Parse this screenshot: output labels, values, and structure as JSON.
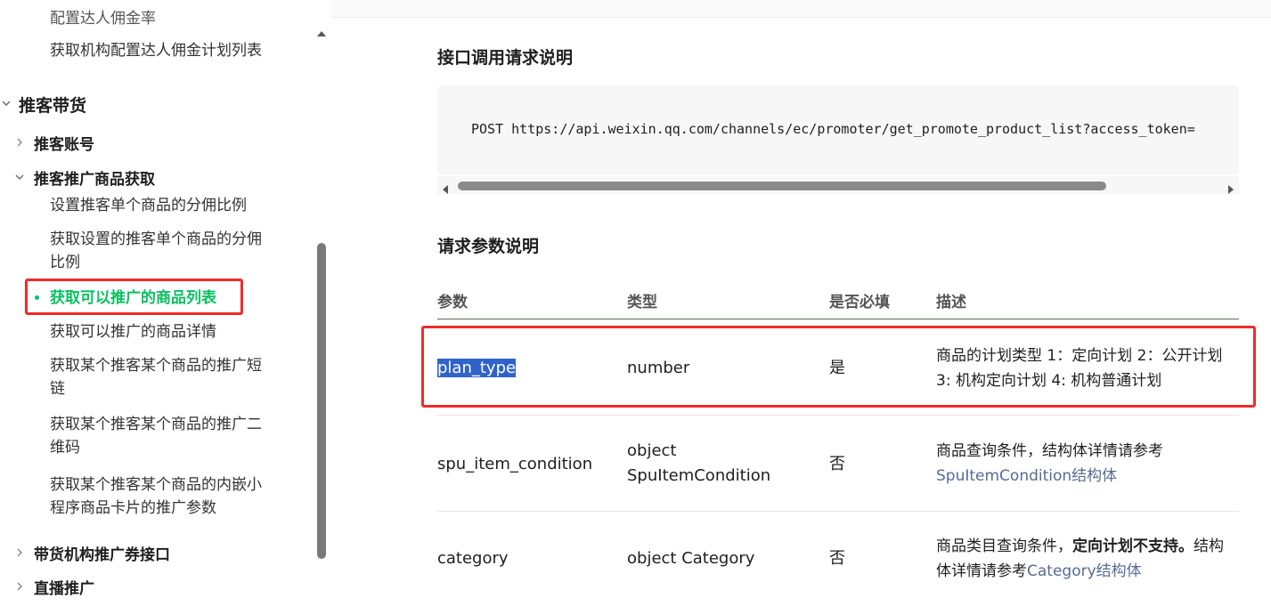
{
  "sidebar": {
    "top_partial": "配置达人佣金率",
    "item_plan_list": "获取机构配置达人佣金计划列表",
    "group_title": "推客带货",
    "sub_account": "推客账号",
    "sub_product": "推客推广商品获取",
    "items": [
      "设置推客单个商品的分佣比例",
      "获取设置的推客单个商品的分佣比例",
      "获取可以推广的商品列表",
      "获取可以推广的商品详情",
      "获取某个推客某个商品的推广短链",
      "获取某个推客某个商品的推广二维码",
      "获取某个推客某个商品的内嵌小程序商品卡片的推广参数"
    ],
    "sub_coupon": "带货机构推广券接口",
    "sub_live": "直播推广"
  },
  "main": {
    "request_heading": "接口调用请求说明",
    "request_code": "POST https://api.weixin.qq.com/channels/ec/promoter/get_promote_product_list?access_token=",
    "params_heading": "请求参数说明",
    "table": {
      "headers": [
        "参数",
        "类型",
        "是否必填",
        "描述"
      ],
      "rows": [
        {
          "param": "plan_type",
          "type": "number",
          "required": "是",
          "desc": "商品的计划类型 1：定向计划 2：公开计划 3: 机构定向计划 4: 机构普通计划"
        },
        {
          "param": "spu_item_condition",
          "type": "object SpuItemCondition",
          "required": "否",
          "desc_prefix": "商品查询条件，结构体详情请参考",
          "desc_link": "SpuItemCondition结构体"
        },
        {
          "param": "category",
          "type": "object Category",
          "required": "否",
          "desc_prefix": "商品类目查询条件，",
          "desc_bold": "定向计划不支持。",
          "desc_mid": "结构体详情请参考",
          "desc_link": "Category结构体"
        }
      ]
    }
  },
  "colors": {
    "accent_green": "#07c160",
    "highlight_red": "#f02b2b",
    "link_blue": "#576b95",
    "selection_blue": "#2f63c9"
  }
}
